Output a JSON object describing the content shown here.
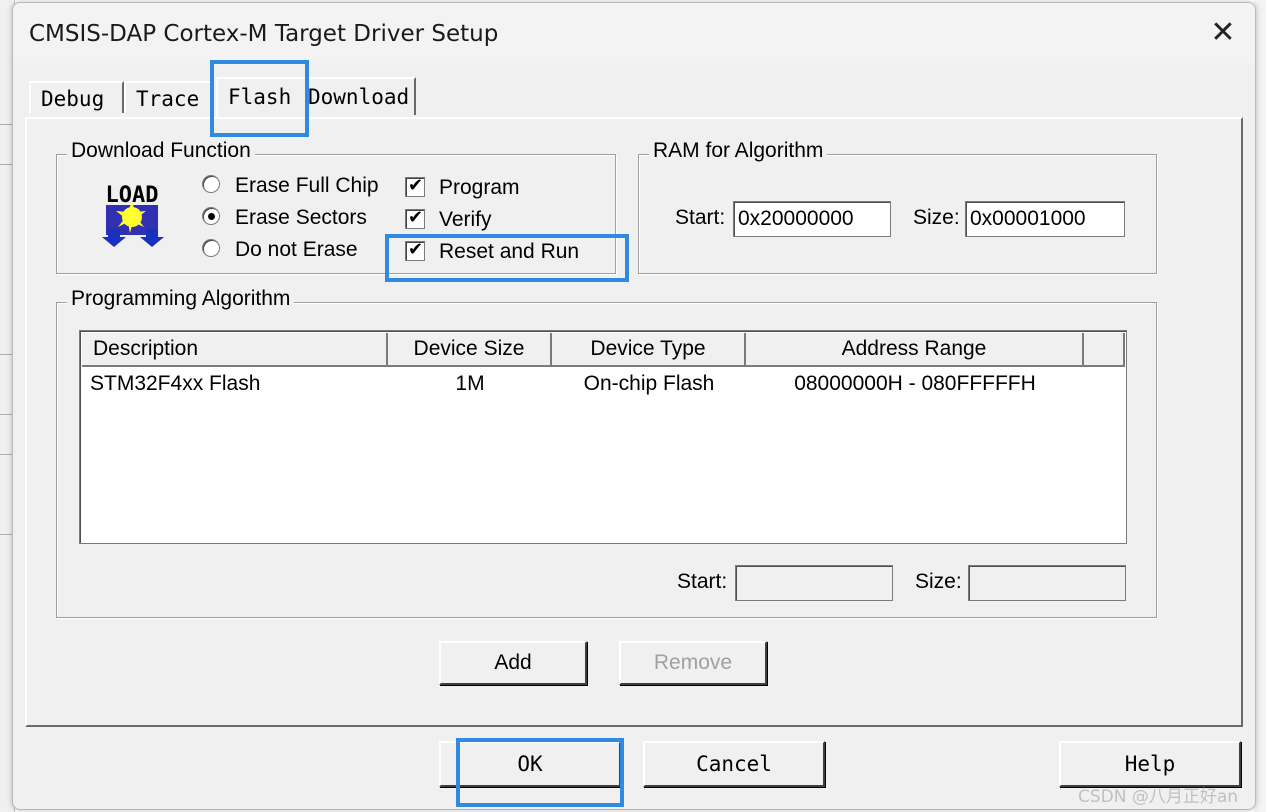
{
  "window": {
    "title": "CMSIS-DAP Cortex-M Target Driver Setup",
    "close_glyph": "✕"
  },
  "tabs": [
    {
      "label": "Debug"
    },
    {
      "label": "Trace"
    },
    {
      "label": "Flash"
    },
    {
      "label": "Download"
    }
  ],
  "download_function": {
    "group_label": "Download Function",
    "load_icon_text": "LOAD",
    "radio_options": [
      {
        "label": "Erase Full Chip",
        "selected": false
      },
      {
        "label": "Erase Sectors",
        "selected": true
      },
      {
        "label": "Do not Erase",
        "selected": false
      }
    ],
    "checkboxes": [
      {
        "label": "Program",
        "checked": true
      },
      {
        "label": "Verify",
        "checked": true
      },
      {
        "label": "Reset and Run",
        "checked": true
      }
    ],
    "check_glyph": "✔"
  },
  "ram_for_algorithm": {
    "group_label": "RAM for Algorithm",
    "start_label": "Start:",
    "start_value": "0x20000000",
    "size_label": "Size:",
    "size_value": "0x00001000"
  },
  "programming_algorithm": {
    "group_label": "Programming Algorithm",
    "columns": [
      "Description",
      "Device Size",
      "Device Type",
      "Address Range"
    ],
    "rows": [
      {
        "description": "STM32F4xx Flash",
        "device_size": "1M",
        "device_type": "On-chip Flash",
        "address_range": "08000000H - 080FFFFFH"
      }
    ],
    "start_label": "Start:",
    "start_value": "",
    "size_label": "Size:",
    "size_value": ""
  },
  "buttons": {
    "add": "Add",
    "remove": "Remove",
    "ok": "OK",
    "cancel": "Cancel",
    "help": "Help"
  },
  "watermark": "CSDN @八月正好an",
  "highlight_color": "#2f8be0"
}
